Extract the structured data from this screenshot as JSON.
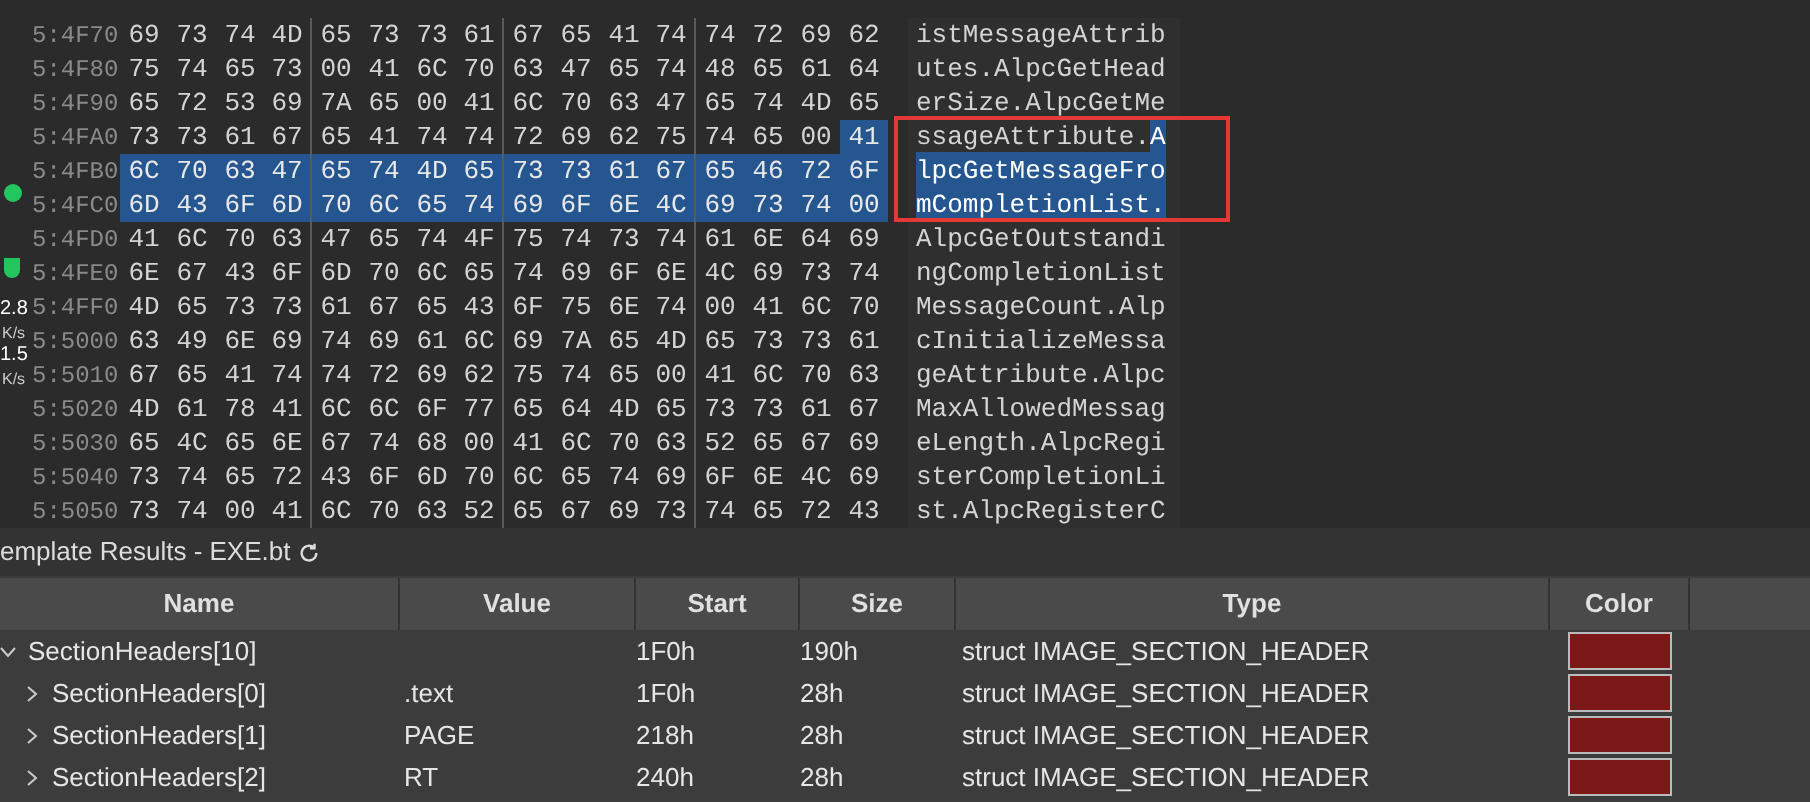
{
  "hex_view": {
    "rows": [
      {
        "address": "5:4F70",
        "bytes": [
          "69",
          "73",
          "74",
          "4D",
          "65",
          "73",
          "73",
          "61",
          "67",
          "65",
          "41",
          "74",
          "74",
          "72",
          "69",
          "62"
        ],
        "text": "istMessageAttrib"
      },
      {
        "address": "5:4F80",
        "bytes": [
          "75",
          "74",
          "65",
          "73",
          "00",
          "41",
          "6C",
          "70",
          "63",
          "47",
          "65",
          "74",
          "48",
          "65",
          "61",
          "64"
        ],
        "text": "utes.AlpcGetHead"
      },
      {
        "address": "5:4F90",
        "bytes": [
          "65",
          "72",
          "53",
          "69",
          "7A",
          "65",
          "00",
          "41",
          "6C",
          "70",
          "63",
          "47",
          "65",
          "74",
          "4D",
          "65"
        ],
        "text": "erSize.AlpcGetMe"
      },
      {
        "address": "5:4FA0",
        "bytes": [
          "73",
          "73",
          "61",
          "67",
          "65",
          "41",
          "74",
          "74",
          "72",
          "69",
          "62",
          "75",
          "74",
          "65",
          "00"
        ],
        "selected_bytes": [
          "41"
        ],
        "text": "ssageAttribute.",
        "selected_text": "A"
      },
      {
        "address": "5:4FB0",
        "selected_bytes": [
          "6C",
          "70",
          "63",
          "47",
          "65",
          "74",
          "4D",
          "65",
          "73",
          "73",
          "61",
          "67",
          "65",
          "46",
          "72",
          "6F"
        ],
        "selected_text": "lpcGetMessageFro"
      },
      {
        "address": "5:4FC0",
        "selected_bytes": [
          "6D",
          "43",
          "6F",
          "6D",
          "70",
          "6C",
          "65",
          "74",
          "69",
          "6F",
          "6E",
          "4C",
          "69",
          "73",
          "74",
          "00"
        ],
        "selected_text": "mCompletionList."
      },
      {
        "address": "5:4FD0",
        "bytes": [
          "41",
          "6C",
          "70",
          "63",
          "47",
          "65",
          "74",
          "4F",
          "75",
          "74",
          "73",
          "74",
          "61",
          "6E",
          "64",
          "69"
        ],
        "text": "AlpcGetOutstandi"
      },
      {
        "address": "5:4FE0",
        "bytes": [
          "6E",
          "67",
          "43",
          "6F",
          "6D",
          "70",
          "6C",
          "65",
          "74",
          "69",
          "6F",
          "6E",
          "4C",
          "69",
          "73",
          "74"
        ],
        "text": "ngCompletionList"
      },
      {
        "address": "5:4FF0",
        "bytes": [
          "4D",
          "65",
          "73",
          "73",
          "61",
          "67",
          "65",
          "43",
          "6F",
          "75",
          "6E",
          "74",
          "00",
          "41",
          "6C",
          "70"
        ],
        "text": "MessageCount.Alp"
      },
      {
        "address": "5:5000",
        "bytes": [
          "63",
          "49",
          "6E",
          "69",
          "74",
          "69",
          "61",
          "6C",
          "69",
          "7A",
          "65",
          "4D",
          "65",
          "73",
          "73",
          "61"
        ],
        "text": "cInitializeMessa"
      },
      {
        "address": "5:5010",
        "bytes": [
          "67",
          "65",
          "41",
          "74",
          "74",
          "72",
          "69",
          "62",
          "75",
          "74",
          "65",
          "00",
          "41",
          "6C",
          "70",
          "63"
        ],
        "text": "geAttribute.Alpc"
      },
      {
        "address": "5:5020",
        "bytes": [
          "4D",
          "61",
          "78",
          "41",
          "6C",
          "6C",
          "6F",
          "77",
          "65",
          "64",
          "4D",
          "65",
          "73",
          "73",
          "61",
          "67"
        ],
        "text": "MaxAllowedMessag"
      },
      {
        "address": "5:5030",
        "bytes": [
          "65",
          "4C",
          "65",
          "6E",
          "67",
          "74",
          "68",
          "00",
          "41",
          "6C",
          "70",
          "63",
          "52",
          "65",
          "67",
          "69"
        ],
        "text": "eLength.AlpcRegi"
      },
      {
        "address": "5:5040",
        "bytes": [
          "73",
          "74",
          "65",
          "72",
          "43",
          "6F",
          "6D",
          "70",
          "6C",
          "65",
          "74",
          "69",
          "6F",
          "6E",
          "4C",
          "69"
        ],
        "text": "sterCompletionLi"
      },
      {
        "address": "5:5050",
        "bytes": [
          "73",
          "74",
          "00",
          "41",
          "6C",
          "70",
          "63",
          "52",
          "65",
          "67",
          "69",
          "73",
          "74",
          "65",
          "72",
          "43"
        ],
        "text": "st.AlpcRegisterC"
      }
    ]
  },
  "network_widget": {
    "upload": "2.8",
    "upload_unit": "K/s",
    "download": "1.5",
    "download_unit": "K/s"
  },
  "template_results": {
    "title": "emplate Results - EXE.bt",
    "columns": [
      "Name",
      "Value",
      "Start",
      "Size",
      "Type",
      "Color"
    ],
    "rows": [
      {
        "name": "SectionHeaders[10]",
        "start": "1F0h",
        "size": "190h",
        "type": "struct IMAGE_SECTION_HEADER",
        "color": "#7b1818",
        "expanded": true,
        "children": [
          {
            "name": "SectionHeaders[0]",
            "value": ".text",
            "start": "1F0h",
            "size": "28h",
            "type": "struct IMAGE_SECTION_HEADER",
            "color": "#7b1818",
            "expanded": false
          },
          {
            "name": "SectionHeaders[1]",
            "value": "PAGE",
            "start": "218h",
            "size": "28h",
            "type": "struct IMAGE_SECTION_HEADER",
            "color": "#7b1818",
            "expanded": false
          },
          {
            "name": "SectionHeaders[2]",
            "value": "RT",
            "start": "240h",
            "size": "28h",
            "type": "struct IMAGE_SECTION_HEADER",
            "color": "#7b1818",
            "expanded": false
          }
        ]
      }
    ]
  }
}
